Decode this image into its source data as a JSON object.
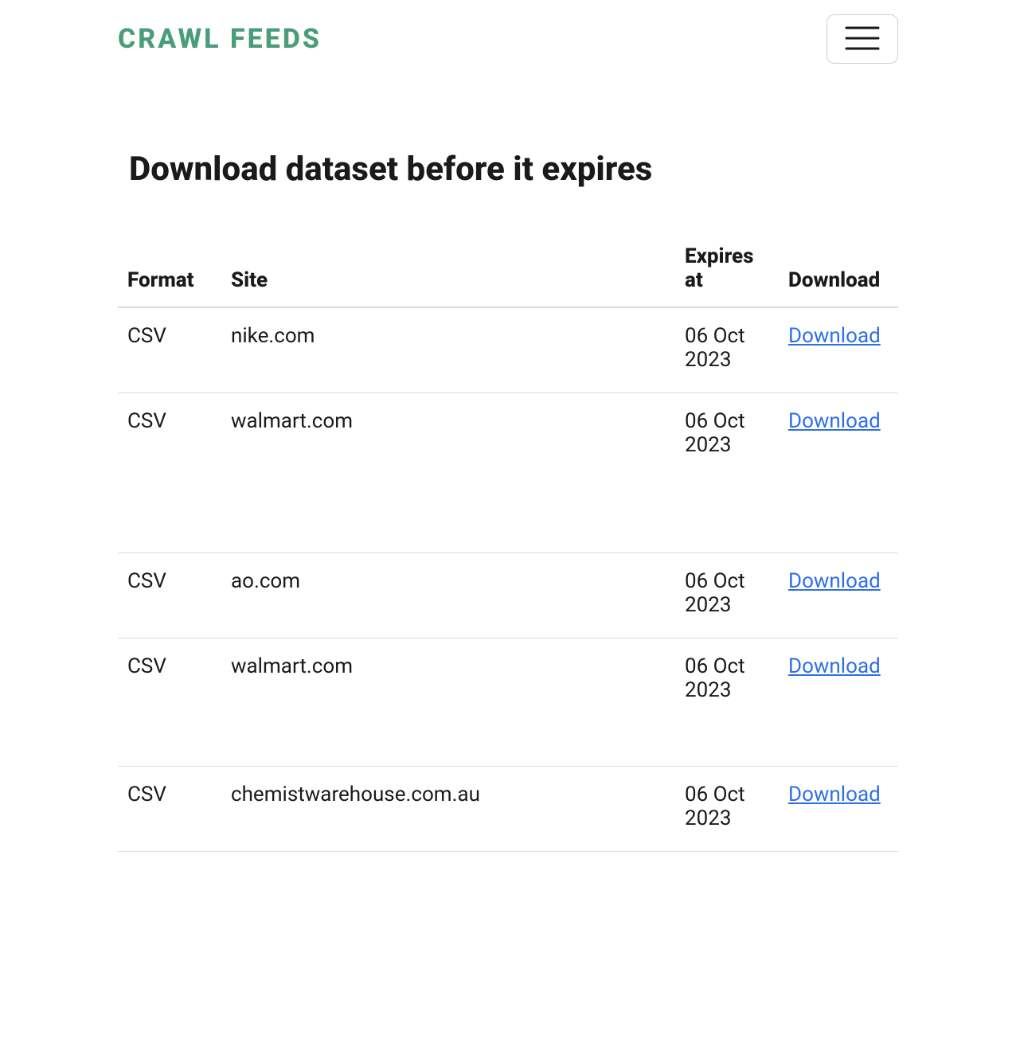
{
  "brand": "CRAWL FEEDS",
  "page": {
    "title": "Download dataset before it expires"
  },
  "table": {
    "headers": {
      "format": "Format",
      "site": "Site",
      "expires": "Expires at",
      "download": "Download"
    },
    "rows": [
      {
        "format": "CSV",
        "site": "nike.com",
        "expires": "06 Oct 2023",
        "download": "Download"
      },
      {
        "format": "CSV",
        "site": "walmart.com",
        "expires": "06 Oct 2023",
        "download": "Download"
      },
      {
        "format": "CSV",
        "site": "ao.com",
        "expires": "06 Oct 2023",
        "download": "Download"
      },
      {
        "format": "CSV",
        "site": "walmart.com",
        "expires": "06 Oct 2023",
        "download": "Download"
      },
      {
        "format": "CSV",
        "site": "chemistwarehouse.com.au",
        "expires": "06 Oct 2023",
        "download": "Download"
      }
    ]
  }
}
